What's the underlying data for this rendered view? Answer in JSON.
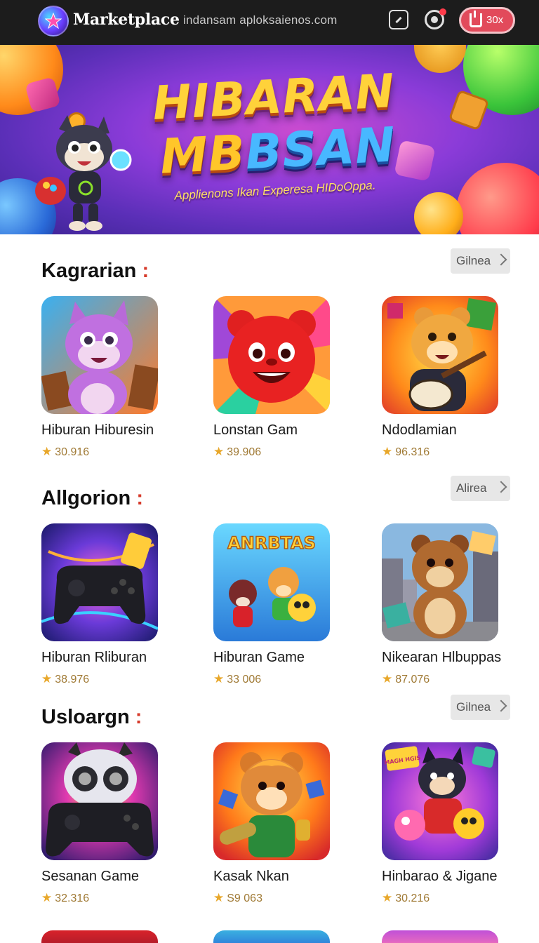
{
  "topbar": {
    "brand": "Marketplace",
    "url": "indansam aploksaienos.com",
    "box_label": "30x",
    "icons": [
      "star-logo-icon",
      "edit-icon",
      "record-icon",
      "box-icon"
    ]
  },
  "banner": {
    "line1": "HIBARAN",
    "line2_a": "MB",
    "line2_b": "BSAN",
    "subtitle": "Applienons Ikan Experesa HIDoOppa."
  },
  "sections": [
    {
      "title": "Kagrarian",
      "more": "Gilnea",
      "apps": [
        {
          "name": "Hiburan Hiburesin",
          "rating": "30.916"
        },
        {
          "name": "Lonstan Gam",
          "rating": "39.906"
        },
        {
          "name": "Ndodlamian",
          "rating": "96.316"
        }
      ]
    },
    {
      "title": "Allgorion",
      "more": "Alirea",
      "apps": [
        {
          "name": "Hiburan Rliburan",
          "rating": "38.976"
        },
        {
          "name": "Hiburan Game",
          "rating": "33 006"
        },
        {
          "name": "Nikearan Hlbuppas",
          "rating": "87.076"
        }
      ]
    },
    {
      "title": "Usloargn",
      "more": "Gilnea",
      "apps": [
        {
          "name": "Sesanan Game",
          "rating": "32.316"
        },
        {
          "name": "Kasak Nkan",
          "rating": "S9 063"
        },
        {
          "name": "Hinbarao & Jigane",
          "rating": "30.216"
        }
      ]
    }
  ],
  "thumb_texts": {
    "anrbtas": "ANRBTAS",
    "badge": "MAGH HGIS"
  },
  "colors": {
    "accent_red": "#d63a2a",
    "star": "#e8a72a",
    "rating_text": "#a07a35",
    "topbar": "#1c1c1c",
    "box_button": "#e24a5b"
  }
}
